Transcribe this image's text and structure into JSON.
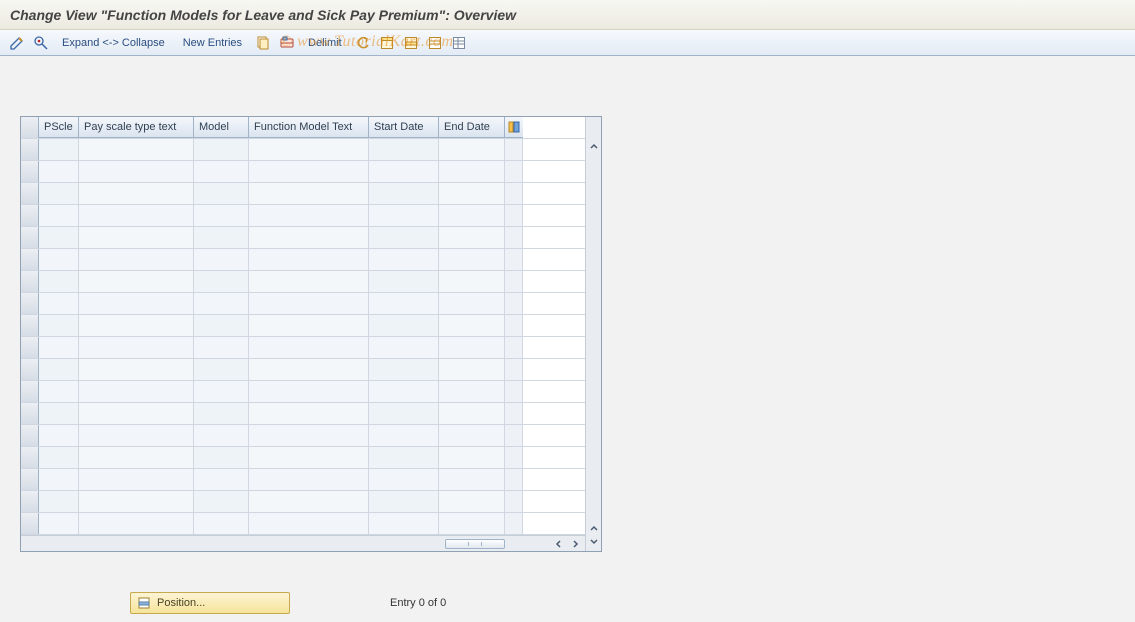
{
  "title": "Change View \"Function Models for Leave and Sick Pay Premium\": Overview",
  "toolbar": {
    "expand_collapse": "Expand <-> Collapse",
    "new_entries": "New Entries",
    "delimit": "Delimit"
  },
  "watermark": "© www.TutorialKart.com",
  "table": {
    "columns": {
      "pscle": "PScle",
      "pay_scale_text": "Pay scale type text",
      "model": "Model",
      "function_model_text": "Function Model Text",
      "start_date": "Start Date",
      "end_date": "End Date"
    },
    "row_count": 18
  },
  "footer": {
    "position_label": "Position...",
    "entry_status": "Entry 0 of 0"
  }
}
